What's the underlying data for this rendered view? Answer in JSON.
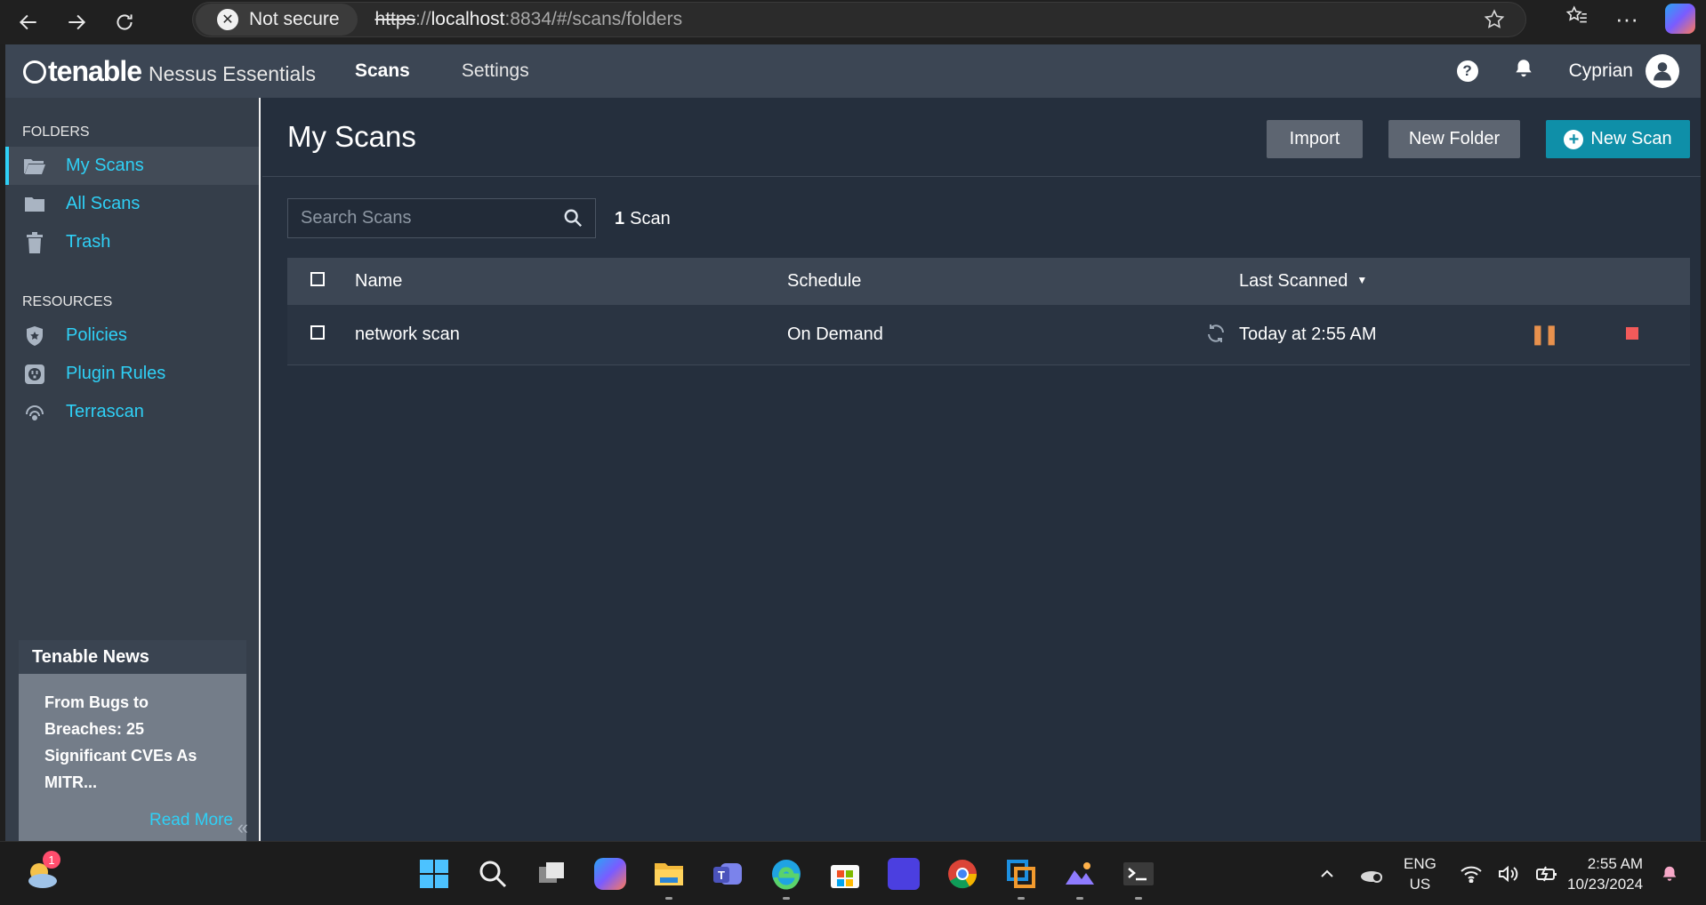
{
  "browser": {
    "secure_label": "Not secure",
    "url_scheme": "https",
    "url_host": "localhost",
    "url_rest": ":8834/#/scans/folders"
  },
  "app": {
    "brand": "tenable",
    "product": "Nessus Essentials",
    "nav": [
      "Scans",
      "Settings"
    ],
    "help_glyph": "?",
    "user_name": "Cyprian"
  },
  "sidebar": {
    "folders_title": "FOLDERS",
    "folders": [
      {
        "label": "My Scans",
        "icon": "folder-open-icon"
      },
      {
        "label": "All Scans",
        "icon": "folder-icon"
      },
      {
        "label": "Trash",
        "icon": "trash-icon"
      }
    ],
    "resources_title": "RESOURCES",
    "resources": [
      {
        "label": "Policies",
        "icon": "shield-star-icon"
      },
      {
        "label": "Plugin Rules",
        "icon": "plug-icon"
      },
      {
        "label": "Terrascan",
        "icon": "radar-icon"
      }
    ],
    "news": {
      "title": "Tenable News",
      "body": "From Bugs to Breaches: 25 Significant CVEs As MITR...",
      "more": "Read More"
    },
    "collapse_glyph": "«"
  },
  "main": {
    "title": "My Scans",
    "buttons": {
      "import": "Import",
      "new_folder": "New Folder",
      "new_scan": "New Scan"
    },
    "search_placeholder": "Search Scans",
    "count_number": "1",
    "count_label": "Scan",
    "table": {
      "headers": [
        "Name",
        "Schedule",
        "Last Scanned"
      ],
      "rows": [
        {
          "name": "network scan",
          "schedule": "On Demand",
          "last_scanned": "Today at 2:55 AM"
        }
      ]
    }
  },
  "taskbar": {
    "weather_badge": "1",
    "lang": "ENG",
    "region": "US",
    "time": "2:55 AM",
    "date": "10/23/2024"
  },
  "colors": {
    "accent": "#2fd0f6",
    "primary_button": "#0f8fa8",
    "topbar": "#3c4654",
    "background": "#252f3d",
    "pause": "#e8914d",
    "stop": "#f25a5a"
  }
}
